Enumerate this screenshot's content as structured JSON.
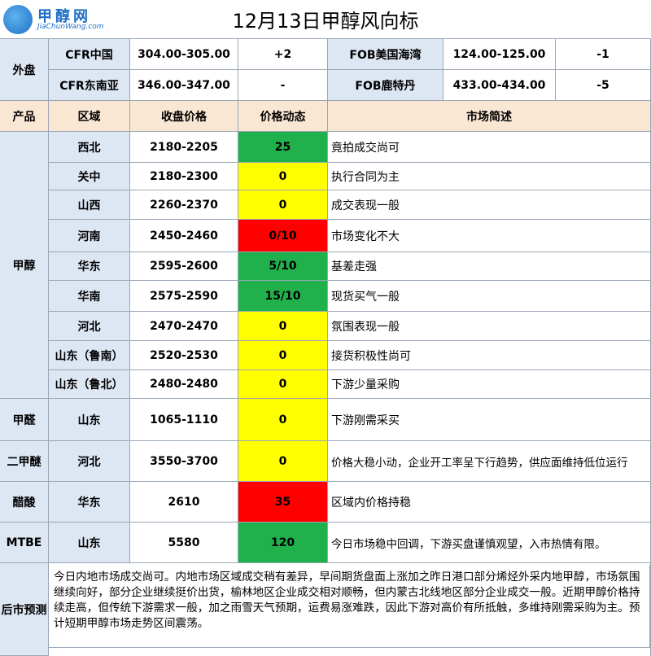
{
  "title": "12月13日甲醇风向标",
  "logo": {
    "cn": "甲醇网",
    "en": "JiaChunWang.com"
  },
  "external": {
    "label": "外盘",
    "rows": [
      {
        "name_a": "CFR中国",
        "price_a": "304.00-305.00",
        "change_a": "+2",
        "name_b": "FOB美国海湾",
        "price_b": "124.00-125.00",
        "change_b": "-1"
      },
      {
        "name_a": "CFR东南亚",
        "price_a": "346.00-347.00",
        "change_a": "-",
        "name_b": "FOB鹿特丹",
        "price_b": "433.00-434.00",
        "change_b": "-5"
      }
    ]
  },
  "header": {
    "product": "产品",
    "region": "区域",
    "price": "收盘价格",
    "dynamic": "价格动态",
    "summary": "市场简述"
  },
  "products": {
    "methanol": "甲醇",
    "formaldehyde": "甲醛",
    "dme": "二甲醚",
    "acetic": "醋酸",
    "mtbe": "MTBE"
  },
  "rows": [
    {
      "region": "西北",
      "price": "2180-2205",
      "dynamic": "25",
      "color": "#20b14c",
      "summary": "竟拍成交尚可"
    },
    {
      "region": "关中",
      "price": "2180-2300",
      "dynamic": "0",
      "color": "#ffff00",
      "summary": "执行合同为主"
    },
    {
      "region": "山西",
      "price": "2260-2370",
      "dynamic": "0",
      "color": "#ffff00",
      "summary": "成交表现一般"
    },
    {
      "region": "河南",
      "price": "2450-2460",
      "dynamic": "0/10",
      "color": "#ff0000",
      "summary": "市场变化不大"
    },
    {
      "region": "华东",
      "price": "2595-2600",
      "dynamic": "5/10",
      "color": "#20b14c",
      "summary": "基差走强"
    },
    {
      "region": "华南",
      "price": "2575-2590",
      "dynamic": "15/10",
      "color": "#20b14c",
      "summary": "现货买气一般"
    },
    {
      "region": "河北",
      "price": "2470-2470",
      "dynamic": "0",
      "color": "#ffff00",
      "summary": "氛围表现一般"
    },
    {
      "region": "山东（鲁南）",
      "price": "2520-2530",
      "dynamic": "0",
      "color": "#ffff00",
      "summary": "接货积极性尚可"
    },
    {
      "region": "山东（鲁北）",
      "price": "2480-2480",
      "dynamic": "0",
      "color": "#ffff00",
      "summary": "下游少量采购"
    },
    {
      "region": "山东",
      "price": "1065-1110",
      "dynamic": "0",
      "color": "#ffff00",
      "summary": "下游刚需采买"
    },
    {
      "region": "河北",
      "price": "3550-3700",
      "dynamic": "0",
      "color": "#ffff00",
      "summary": "价格大稳小动，企业开工率呈下行趋势，供应面维持低位运行"
    },
    {
      "region": "华东",
      "price": "2610",
      "dynamic": "35",
      "color": "#ff0000",
      "summary": "区域内价格持稳"
    },
    {
      "region": "山东",
      "price": "5580",
      "dynamic": "120",
      "color": "#20b14c",
      "summary": "今日市场稳中回调，下游买盘谨慎观望，入市热情有限。"
    }
  ],
  "outlook": {
    "label": "后市预测",
    "text": "今日内地市场成交尚可。内地市场区域成交稍有差异，早间期货盘面上涨加之昨日港口部分烯烃外采内地甲醇，市场氛围继续向好，部分企业继续挺价出货，榆林地区企业成交相对顺畅，但内蒙古北线地区部分企业成交一般。近期甲醇价格持续走高，但传统下游需求一般，加之雨雪天气预期，运费易涨难跌，因此下游对高价有所抵触，多维持刚需采购为主。预计短期甲醇市场走势区间震荡。"
  }
}
